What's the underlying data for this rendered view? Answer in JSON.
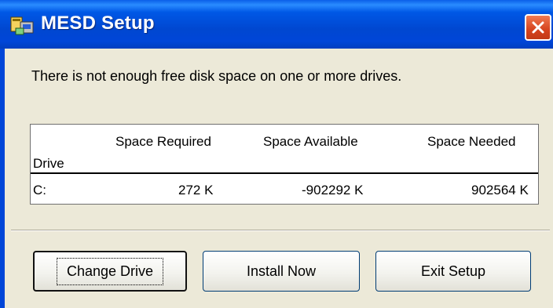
{
  "window": {
    "title": "MESD Setup"
  },
  "message": "There is not enough free disk space on one or more drives.",
  "table": {
    "columns": [
      "Drive",
      "Space Required",
      "Space Available",
      "Space Needed"
    ],
    "rows": [
      {
        "drive": "C:",
        "required": "272 K",
        "available": "-902292 K",
        "needed": "902564 K"
      }
    ]
  },
  "buttons": {
    "change_drive": "Change Drive",
    "install_now": "Install Now",
    "exit_setup": "Exit Setup"
  },
  "icons": [
    "setup-icon",
    "close-icon"
  ],
  "colors": {
    "titlebar": "#0046d8",
    "close": "#d6431e",
    "dialog": "#ece9d8"
  }
}
